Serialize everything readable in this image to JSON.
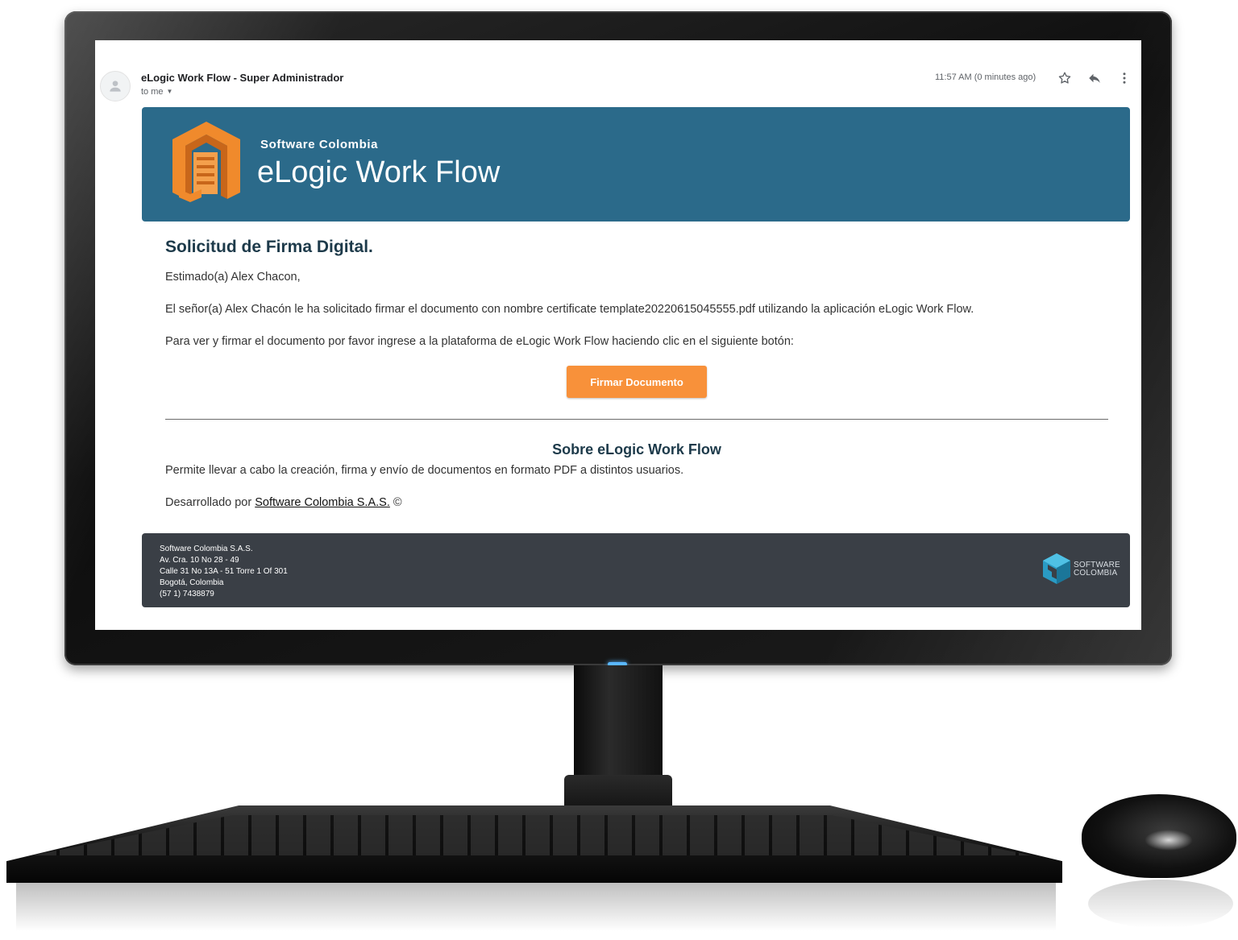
{
  "email": {
    "sender": "eLogic Work Flow - Super Administrador",
    "recipient": "to me",
    "timestamp": "11:57 AM (0 minutes ago)",
    "icons": {
      "avatar": "person-icon",
      "star": "star-icon",
      "reply": "reply-icon",
      "more": "more-vert-icon"
    }
  },
  "banner": {
    "company": "Software Colombia",
    "product": "eLogic Work Flow",
    "background_color": "#2b6a8a",
    "logo_color": "#f08a2c"
  },
  "content": {
    "title": "Solicitud de Firma Digital.",
    "greeting": "Estimado(a) Alex Chacon,",
    "request": "El señor(a) Alex Chacón le ha solicitado firmar el documento con nombre certificate template20220615045555.pdf utilizando la aplicación eLogic Work Flow.",
    "instruction": "Para ver y firmar el documento por favor ingrese a la plataforma de eLogic Work Flow haciendo clic en el siguiente botón:",
    "button_label": "Firmar Documento",
    "button_color": "#f8913a"
  },
  "about": {
    "title": "Sobre eLogic Work Flow",
    "description": "Permite llevar a cabo la creación, firma y envío de documentos en formato PDF a distintos usuarios.",
    "developed_prefix": "Desarrollado por",
    "developer_link": "Software Colombia S.A.S.",
    "copyright": "©"
  },
  "footer": {
    "lines": [
      "Software Colombia S.A.S.",
      "Av. Cra. 10 No 28 - 49",
      "Calle 31 No 13A - 51 Torre 1 Of 301",
      "Bogotá, Colombia",
      "(57 1) 7438879"
    ],
    "logo_line1": "SOFTWARE",
    "logo_line2": "COLOMBIA",
    "background_color": "#3a3f46"
  }
}
